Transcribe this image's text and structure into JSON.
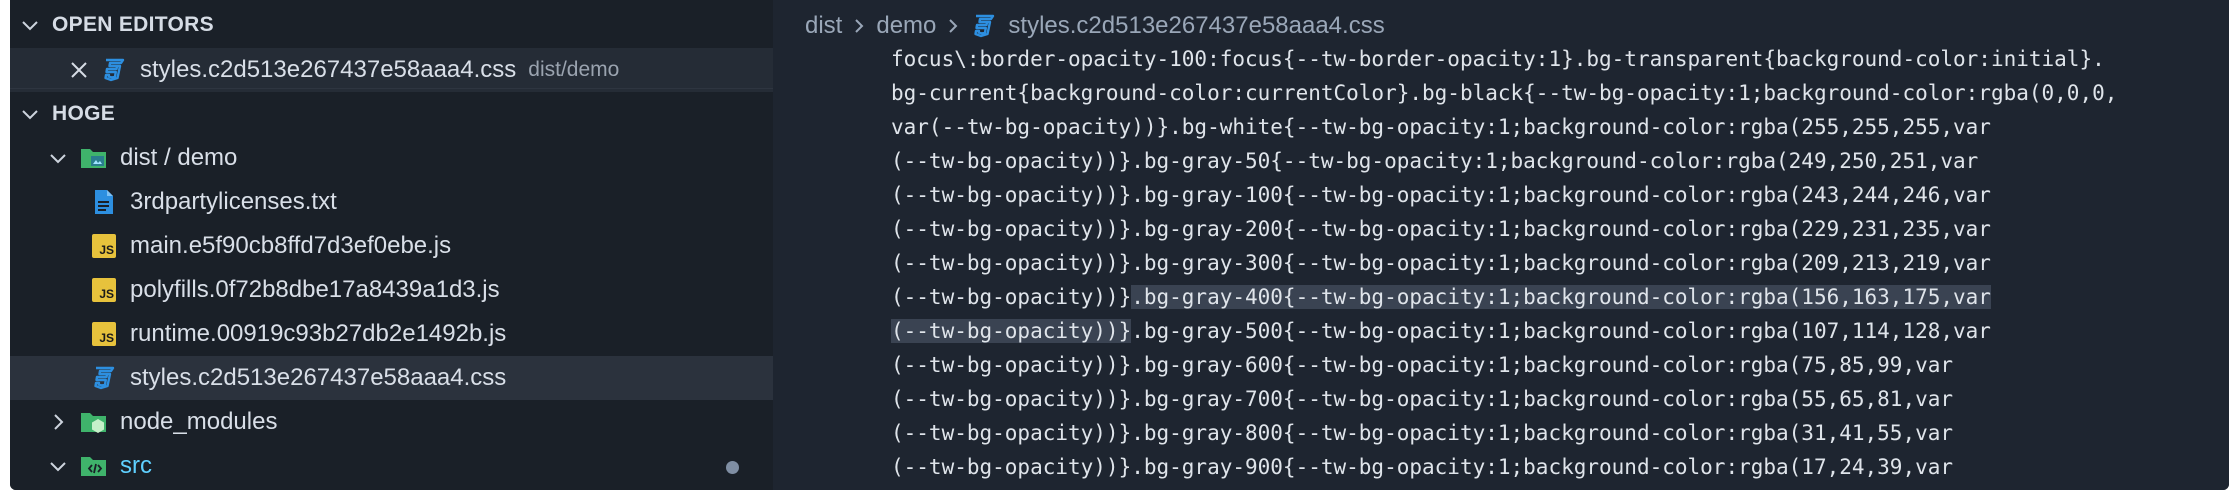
{
  "sidebar": {
    "open_editors_header": "OPEN EDITORS",
    "open_editor": {
      "file": "styles.c2d513e267437e58aaa4.css",
      "path": "dist/demo"
    },
    "workspace_header": "HOGE",
    "tree": [
      {
        "label": "dist / demo",
        "type": "folder-open"
      },
      {
        "label": "3rdpartylicenses.txt",
        "type": "txt"
      },
      {
        "label": "main.e5f90cb8ffd7d3ef0ebe.js",
        "type": "js"
      },
      {
        "label": "polyfills.0f72b8dbe17a8439a1d3.js",
        "type": "js"
      },
      {
        "label": "runtime.00919c93b27db2e1492b.js",
        "type": "js"
      },
      {
        "label": "styles.c2d513e267437e58aaa4.css",
        "type": "css"
      },
      {
        "label": "node_modules",
        "type": "folder-closed"
      },
      {
        "label": "src",
        "type": "folder-open"
      }
    ]
  },
  "breadcrumb": {
    "items": [
      "dist",
      "demo",
      "styles.c2d513e267437e58aaa4.css"
    ]
  },
  "code_lines": [
    {
      "pre": "focus\\:border-opacity-100:focus{--tw-border-opacity:1}.bg-transparent{background-color:initial}.",
      "hl": "",
      "post": ""
    },
    {
      "pre": "bg-current{background-color:currentColor}.bg-black{--tw-bg-opacity:1;background-color:rgba(0,0,0,",
      "hl": "",
      "post": ""
    },
    {
      "pre": "var(--tw-bg-opacity))}.bg-white{--tw-bg-opacity:1;background-color:rgba(255,255,255,var",
      "hl": "",
      "post": ""
    },
    {
      "pre": "(--tw-bg-opacity))}.bg-gray-50{--tw-bg-opacity:1;background-color:rgba(249,250,251,var",
      "hl": "",
      "post": ""
    },
    {
      "pre": "(--tw-bg-opacity))}.bg-gray-100{--tw-bg-opacity:1;background-color:rgba(243,244,246,var",
      "hl": "",
      "post": ""
    },
    {
      "pre": "(--tw-bg-opacity))}.bg-gray-200{--tw-bg-opacity:1;background-color:rgba(229,231,235,var",
      "hl": "",
      "post": ""
    },
    {
      "pre": "(--tw-bg-opacity))}.bg-gray-300{--tw-bg-opacity:1;background-color:rgba(209,213,219,var",
      "hl": "",
      "post": ""
    },
    {
      "pre": "(--tw-bg-opacity))}",
      "hl": ".bg-gray-400{--tw-bg-opacity:1;background-color:rgba(156,163,175,var",
      "post": ""
    },
    {
      "pre": "",
      "hl": "(--tw-bg-opacity))}",
      "post": ".bg-gray-500{--tw-bg-opacity:1;background-color:rgba(107,114,128,var"
    },
    {
      "pre": "(--tw-bg-opacity))}.bg-gray-600{--tw-bg-opacity:1;background-color:rgba(75,85,99,var",
      "hl": "",
      "post": ""
    },
    {
      "pre": "(--tw-bg-opacity))}.bg-gray-700{--tw-bg-opacity:1;background-color:rgba(55,65,81,var",
      "hl": "",
      "post": ""
    },
    {
      "pre": "(--tw-bg-opacity))}.bg-gray-800{--tw-bg-opacity:1;background-color:rgba(31,41,55,var",
      "hl": "",
      "post": ""
    },
    {
      "pre": "(--tw-bg-opacity))}.bg-gray-900{--tw-bg-opacity:1;background-color:rgba(17,24,39,var",
      "hl": "",
      "post": ""
    }
  ],
  "colors": {
    "css_icon": "#2d8fe0",
    "js_icon": "#e7c23c",
    "folder_green": "#3fb36b",
    "src_label": "#5fd0ff",
    "selection": "#3a4352"
  }
}
